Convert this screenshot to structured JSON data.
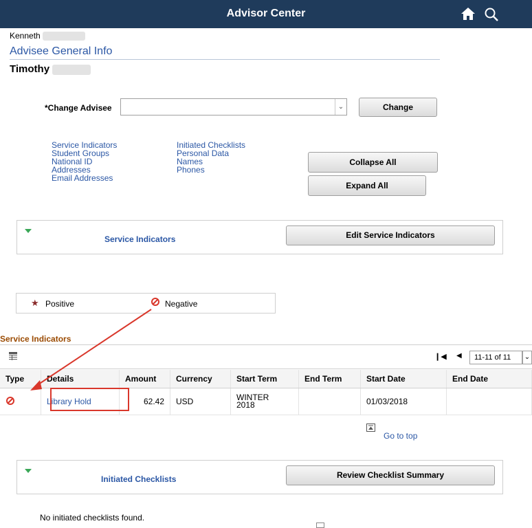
{
  "header": {
    "title": "Advisor Center",
    "home_icon": "home-icon",
    "search_icon": "search-icon",
    "bg_color": "#1f3b5b"
  },
  "advisor": {
    "first_name": "Kenneth"
  },
  "page_title": "Advisee General Info",
  "advisee": {
    "first_name": "Timothy"
  },
  "change_advisee": {
    "label": "*Change Advisee",
    "value": "",
    "button": "Change"
  },
  "quick_links": {
    "col1": [
      "Service Indicators",
      "Student Groups",
      "National ID",
      "Addresses",
      "Email Addresses"
    ],
    "col2": [
      "Initiated Checklists",
      "Personal Data",
      "Names",
      "Phones"
    ]
  },
  "buttons": {
    "collapse_all": "Collapse All",
    "expand_all": "Expand All"
  },
  "service_indicators_section": {
    "title": "Service Indicators",
    "button": "Edit Service Indicators"
  },
  "legend": {
    "positive": "Positive",
    "negative": "Negative"
  },
  "grid": {
    "title": "Service Indicators",
    "pagination": "11-11 of 11",
    "columns": [
      "Type",
      "Details",
      "Amount",
      "Currency",
      "Start Term",
      "End Term",
      "Start Date",
      "End Date"
    ],
    "rows": [
      {
        "type": "negative",
        "details": "Library Hold",
        "amount": "62.42",
        "currency": "USD",
        "start_term_1": "WINTER",
        "start_term_2": "2018",
        "end_term": "",
        "start_date": "01/03/2018",
        "end_date": ""
      }
    ]
  },
  "go_to_top": "Go to top",
  "checklists_section": {
    "title": "Initiated Checklists",
    "button": "Review Checklist Summary",
    "empty_message": "No initiated checklists found."
  },
  "colors": {
    "link": "#2b57a5",
    "section_title": "#9a4a00",
    "annotation": "#d9372b",
    "expand_triangle": "#3aa757"
  }
}
